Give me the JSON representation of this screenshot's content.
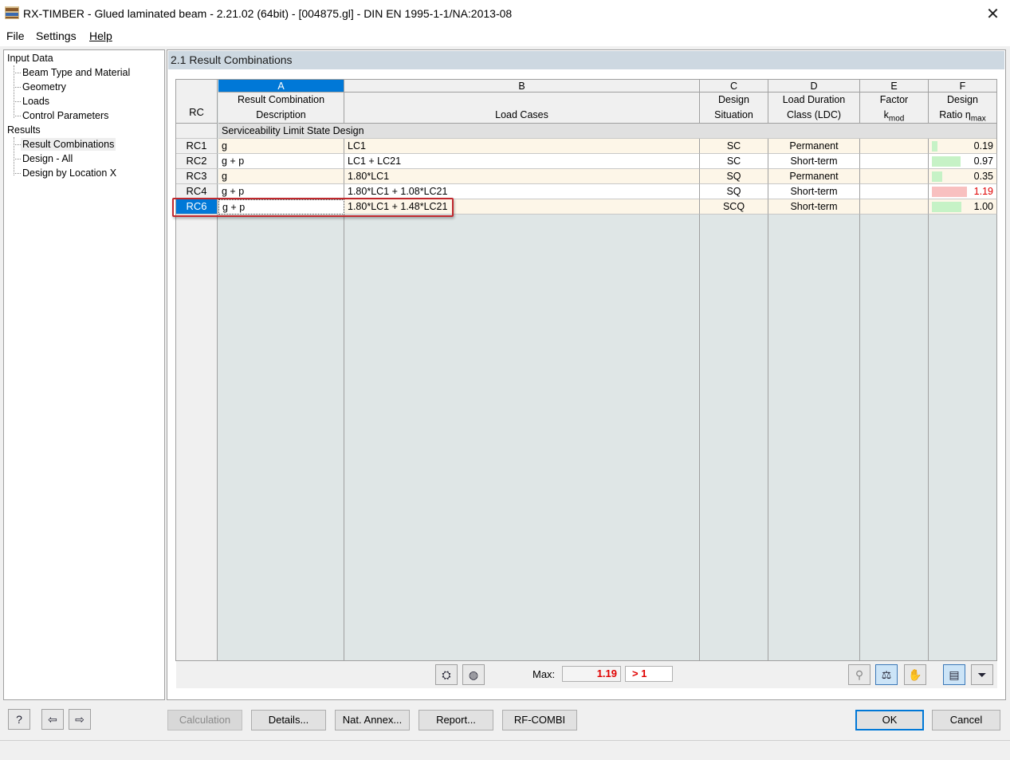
{
  "window": {
    "title": "RX-TIMBER - Glued laminated beam - 2.21.02 (64bit) - [004875.gl] - DIN EN 1995-1-1/NA:2013-08"
  },
  "menu": {
    "items": [
      "File",
      "Settings",
      "Help"
    ]
  },
  "tree": {
    "input_data": "Input Data",
    "input_items": [
      "Beam Type and Material",
      "Geometry",
      "Loads",
      "Control Parameters"
    ],
    "results": "Results",
    "result_items": [
      "Result Combinations",
      "Design - All",
      "Design by Location X"
    ],
    "selected": "Result Combinations"
  },
  "panel": {
    "title": "2.1 Result Combinations"
  },
  "table": {
    "rc_header": "RC",
    "columns": [
      {
        "letter": "A",
        "label1": "Result Combination",
        "label2": "Description"
      },
      {
        "letter": "B",
        "label1": "",
        "label2": "Load Cases"
      },
      {
        "letter": "C",
        "label1": "Design",
        "label2": "Situation"
      },
      {
        "letter": "D",
        "label1": "Load Duration",
        "label2": "Class (LDC)"
      },
      {
        "letter": "E",
        "label1": "Factor",
        "label2": "k",
        "label2_sub": "mod"
      },
      {
        "letter": "F",
        "label1": "Design",
        "label2": "Ratio η",
        "label2_sub": "max"
      }
    ],
    "group_label": "Serviceability Limit State Design",
    "rows": [
      {
        "rc": "RC1",
        "desc": "g",
        "load_cases": "LC1",
        "situation": "SC",
        "ldc": "Permanent",
        "kmod": "",
        "ratio": "0.19",
        "ratio_value": 0.19,
        "over": false
      },
      {
        "rc": "RC2",
        "desc": "g + p",
        "load_cases": "LC1 + LC21",
        "situation": "SC",
        "ldc": "Short-term",
        "kmod": "",
        "ratio": "0.97",
        "ratio_value": 0.97,
        "over": false
      },
      {
        "rc": "RC3",
        "desc": "g",
        "load_cases": "1.80*LC1",
        "situation": "SQ",
        "ldc": "Permanent",
        "kmod": "",
        "ratio": "0.35",
        "ratio_value": 0.35,
        "over": false
      },
      {
        "rc": "RC4",
        "desc": "g + p",
        "load_cases": "1.80*LC1 + 1.08*LC21",
        "situation": "SQ",
        "ldc": "Short-term",
        "kmod": "",
        "ratio": "1.19",
        "ratio_value": 1.19,
        "over": true
      },
      {
        "rc": "RC6",
        "desc": "g + p",
        "load_cases": "1.80*LC1 + 1.48*LC21",
        "situation": "SCQ",
        "ldc": "Short-term",
        "kmod": "",
        "ratio": "1.00",
        "ratio_value": 1.0,
        "over": false
      }
    ],
    "selected_row": "RC6"
  },
  "footer": {
    "max_label": "Max:",
    "max_value": "1.19",
    "gt_label": "> 1"
  },
  "buttons": {
    "calculation": "Calculation",
    "details": "Details...",
    "nat_annex": "Nat. Annex...",
    "report": "Report...",
    "rf_combi": "RF-COMBI",
    "ok": "OK",
    "cancel": "Cancel"
  },
  "colors": {
    "selection": "#0078d7",
    "bar_ok": "#c6f2c6",
    "bar_over": "#f8c0c0",
    "over_text": "#e00000",
    "highlight": "#c0282d"
  }
}
